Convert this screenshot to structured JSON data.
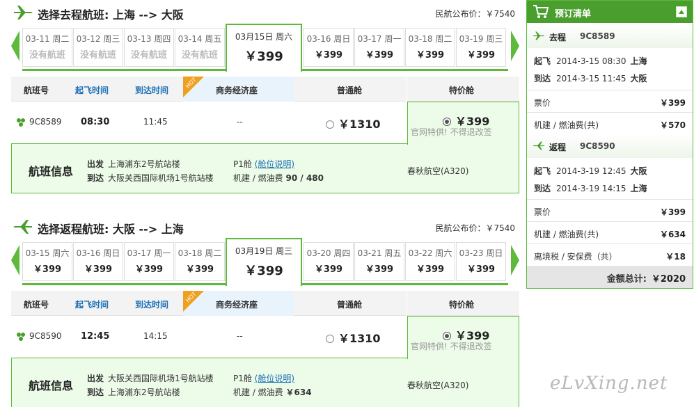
{
  "colors": {
    "accent_green": "#5dba3b",
    "dark_green": "#4a9e2e",
    "link_blue": "#1a6fb5",
    "special_bg": "#edfbe9"
  },
  "outbound": {
    "title": "选择去程航班: 上海 --> 大阪",
    "public_price": "民航公布价：￥7540",
    "dates": [
      {
        "label": "03-11 周二",
        "price": "没有航班",
        "none": true
      },
      {
        "label": "03-12 周三",
        "price": "没有航班",
        "none": true
      },
      {
        "label": "03-13 周四",
        "price": "没有航班",
        "none": true
      },
      {
        "label": "03-14 周五",
        "price": "没有航班",
        "none": true
      },
      {
        "label": "03月15日 周六",
        "price": "￥399",
        "active": true
      },
      {
        "label": "03-16 周日",
        "price": "￥399"
      },
      {
        "label": "03-17 周一",
        "price": "￥399"
      },
      {
        "label": "03-18 周二",
        "price": "￥399"
      },
      {
        "label": "03-19 周三",
        "price": "￥399"
      }
    ],
    "headers": {
      "flight_no": "航班号",
      "dep_time": "起飞时间",
      "arr_time": "到达时间",
      "business": "商务经济座",
      "economy": "普通舱",
      "special": "特价舱"
    },
    "flight": {
      "no": "9C8589",
      "dep": "08:30",
      "arr": "11:45",
      "business": "--",
      "economy": "￥1310",
      "special": "￥399",
      "special_note": "官网特供! 不得退改签"
    },
    "info": {
      "title": "航班信息",
      "dep_label": "出发",
      "dep_place": "上海浦东2号航站楼",
      "arr_label": "到达",
      "arr_place": "大阪关西国际机场1号航站楼",
      "cabin": "P1舱",
      "cabin_link": "(舱位说明)",
      "fee_label": "机建 / 燃油费",
      "fee_value": "90 / 480",
      "airline": "春秋航空(A320)"
    }
  },
  "return": {
    "title": "选择返程航班: 大阪 --> 上海",
    "public_price": "民航公布价：￥7540",
    "dates": [
      {
        "label": "03-15 周六",
        "price": "￥399"
      },
      {
        "label": "03-16 周日",
        "price": "￥399"
      },
      {
        "label": "03-17 周一",
        "price": "￥399"
      },
      {
        "label": "03-18 周二",
        "price": "￥399"
      },
      {
        "label": "03月19日 周三",
        "price": "￥399",
        "active": true
      },
      {
        "label": "03-20 周四",
        "price": "￥399"
      },
      {
        "label": "03-21 周五",
        "price": "￥399"
      },
      {
        "label": "03-22 周六",
        "price": "￥399"
      },
      {
        "label": "03-23 周日",
        "price": "￥399"
      }
    ],
    "headers": {
      "flight_no": "航班号",
      "dep_time": "起飞时间",
      "arr_time": "到达时间",
      "business": "商务经济座",
      "economy": "普通舱",
      "special": "特价舱"
    },
    "flight": {
      "no": "9C8590",
      "dep": "12:45",
      "arr": "14:15",
      "business": "--",
      "economy": "￥1310",
      "special": "￥399",
      "special_note": "官网特供! 不得退改签"
    },
    "info": {
      "title": "航班信息",
      "dep_label": "出发",
      "dep_place": "大阪关西国际机场1号航站楼",
      "arr_label": "到达",
      "arr_place": "上海浦东2号航站楼",
      "cabin": "P1舱",
      "cabin_link": "(舱位说明)",
      "fee_label": "机建 / 燃油费",
      "fee_value": "￥634",
      "airline": "春秋航空(A320)"
    }
  },
  "hot_badge": "HOT",
  "order": {
    "title": "预订清单",
    "outbound": {
      "label": "去程",
      "flight": "9C8589",
      "dep_label": "起飞",
      "dep_time": "2014-3-15 08:30",
      "dep_city": "上海",
      "arr_label": "到达",
      "arr_time": "2014-3-15 11:45",
      "arr_city": "大阪",
      "fare_label": "票价",
      "fare": "￥399",
      "fee_label": "机建 / 燃油费(共)",
      "fee": "￥570"
    },
    "return": {
      "label": "返程",
      "flight": "9C8590",
      "dep_label": "起飞",
      "dep_time": "2014-3-19 12:45",
      "dep_city": "大阪",
      "arr_label": "到达",
      "arr_time": "2014-3-19 14:15",
      "arr_city": "上海",
      "fare_label": "票价",
      "fare": "￥399",
      "fee_label": "机建 / 燃油费(共)",
      "fee": "￥634"
    },
    "tax_label": "离境税 / 安保费（共）",
    "tax": "￥18",
    "total_label": "金额总计:",
    "total": "￥2020"
  },
  "watermark": "eLvXing.net"
}
